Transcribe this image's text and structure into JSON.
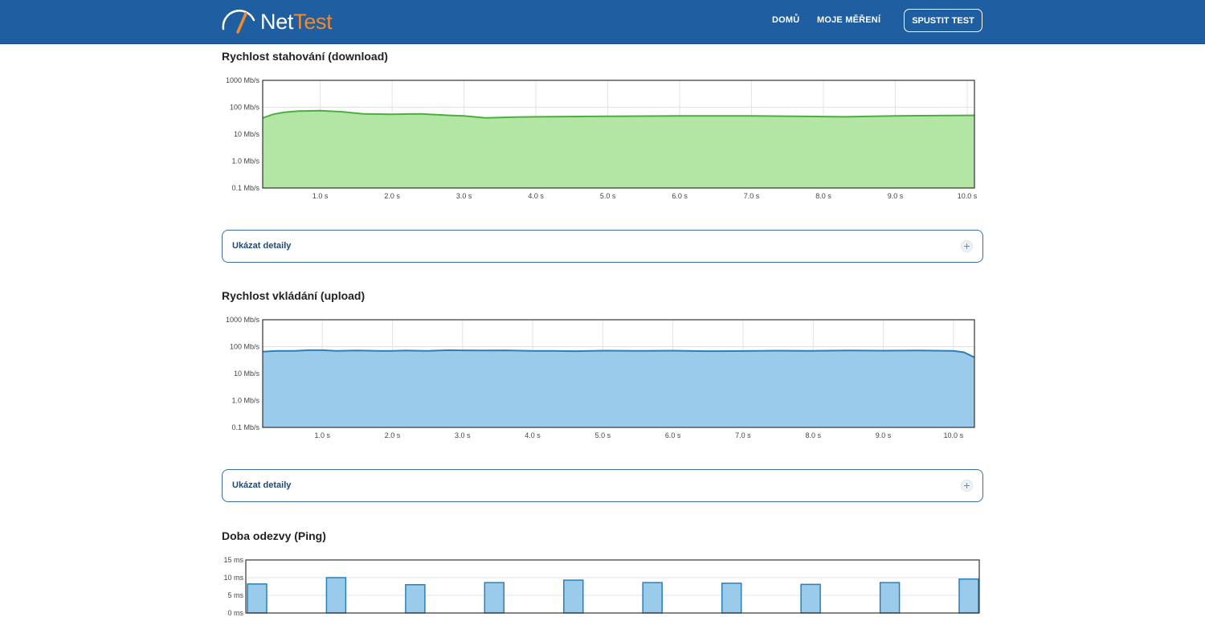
{
  "header": {
    "logo_net": "Net",
    "logo_test": "Test",
    "nav": [
      {
        "label": "DOMŮ"
      },
      {
        "label": "MOJE MĚŘENÍ"
      }
    ],
    "cta_label": "SPUSTIT TEST"
  },
  "colors": {
    "header_bg": "#1f5ea0",
    "accent": "#f08a2c",
    "download_fill": "#b3e6a5",
    "download_line": "#4caf3d",
    "upload_fill": "#9bcbea",
    "upload_line": "#2a7fb8",
    "ping_fill": "#9bcbea",
    "ping_line": "#2a7fb8"
  },
  "sections": {
    "download": {
      "title": "Rychlost stahování (download)",
      "details_label": "Ukázat detaily"
    },
    "upload": {
      "title": "Rychlost vkládání (upload)",
      "details_label": "Ukázat detaily"
    },
    "ping": {
      "title": "Doba odezvy (Ping)"
    }
  },
  "chart_data": [
    {
      "type": "area",
      "title": "Rychlost stahování (download)",
      "y_scale": "log",
      "ylim": [
        0.1,
        1000
      ],
      "y_ticks": [
        "0.1 Mb/s",
        "1.0 Mb/s",
        "10 Mb/s",
        "100 Mb/s",
        "1000 Mb/s"
      ],
      "xlim": [
        0.2,
        10.1
      ],
      "x_ticks": [
        "1.0 s",
        "2.0 s",
        "3.0 s",
        "4.0 s",
        "5.0 s",
        "6.0 s",
        "7.0 s",
        "8.0 s",
        "9.0 s",
        "10.0 s"
      ],
      "grid": true,
      "x": [
        0.2,
        0.35,
        0.5,
        0.7,
        1.0,
        1.3,
        1.6,
        2.0,
        2.4,
        2.8,
        3.0,
        3.3,
        3.7,
        4.0,
        5.0,
        6.0,
        7.0,
        8.0,
        8.3,
        9.0,
        10.1
      ],
      "y": [
        40,
        55,
        65,
        72,
        75,
        68,
        57,
        55,
        57,
        50,
        48,
        40,
        43,
        44,
        46,
        48,
        48,
        45,
        44,
        48,
        50
      ]
    },
    {
      "type": "area",
      "title": "Rychlost vkládání (upload)",
      "y_scale": "log",
      "ylim": [
        0.1,
        1000
      ],
      "y_ticks": [
        "0.1 Mb/s",
        "1.0 Mb/s",
        "10 Mb/s",
        "100 Mb/s",
        "1000 Mb/s"
      ],
      "xlim": [
        0.15,
        10.3
      ],
      "x_ticks": [
        "1.0 s",
        "2.0 s",
        "3.0 s",
        "4.0 s",
        "5.0 s",
        "6.0 s",
        "7.0 s",
        "8.0 s",
        "9.0 s",
        "10.0 s"
      ],
      "grid": true,
      "x": [
        0.15,
        0.35,
        0.6,
        0.8,
        1.0,
        1.2,
        1.5,
        1.8,
        2.0,
        2.2,
        2.5,
        2.8,
        3.0,
        3.3,
        3.6,
        4.0,
        4.3,
        4.6,
        5.0,
        5.5,
        6.0,
        6.5,
        7.0,
        7.5,
        8.0,
        8.5,
        9.0,
        9.5,
        10.0,
        10.15,
        10.3
      ],
      "y": [
        65,
        70,
        70,
        74,
        74,
        70,
        72,
        70,
        70,
        72,
        70,
        74,
        73,
        72,
        73,
        70,
        70,
        68,
        71,
        70,
        71,
        68,
        69,
        71,
        70,
        72,
        71,
        72,
        70,
        62,
        40
      ]
    },
    {
      "type": "bar",
      "title": "Doba odezvy (Ping)",
      "ylim": [
        0,
        15
      ],
      "y_ticks": [
        "0 ms",
        "5 ms",
        "10 ms",
        "15 ms"
      ],
      "grid": true,
      "values": [
        8.2,
        10.0,
        8.0,
        8.6,
        9.3,
        8.6,
        8.4,
        8.1,
        8.6,
        9.6
      ]
    }
  ]
}
